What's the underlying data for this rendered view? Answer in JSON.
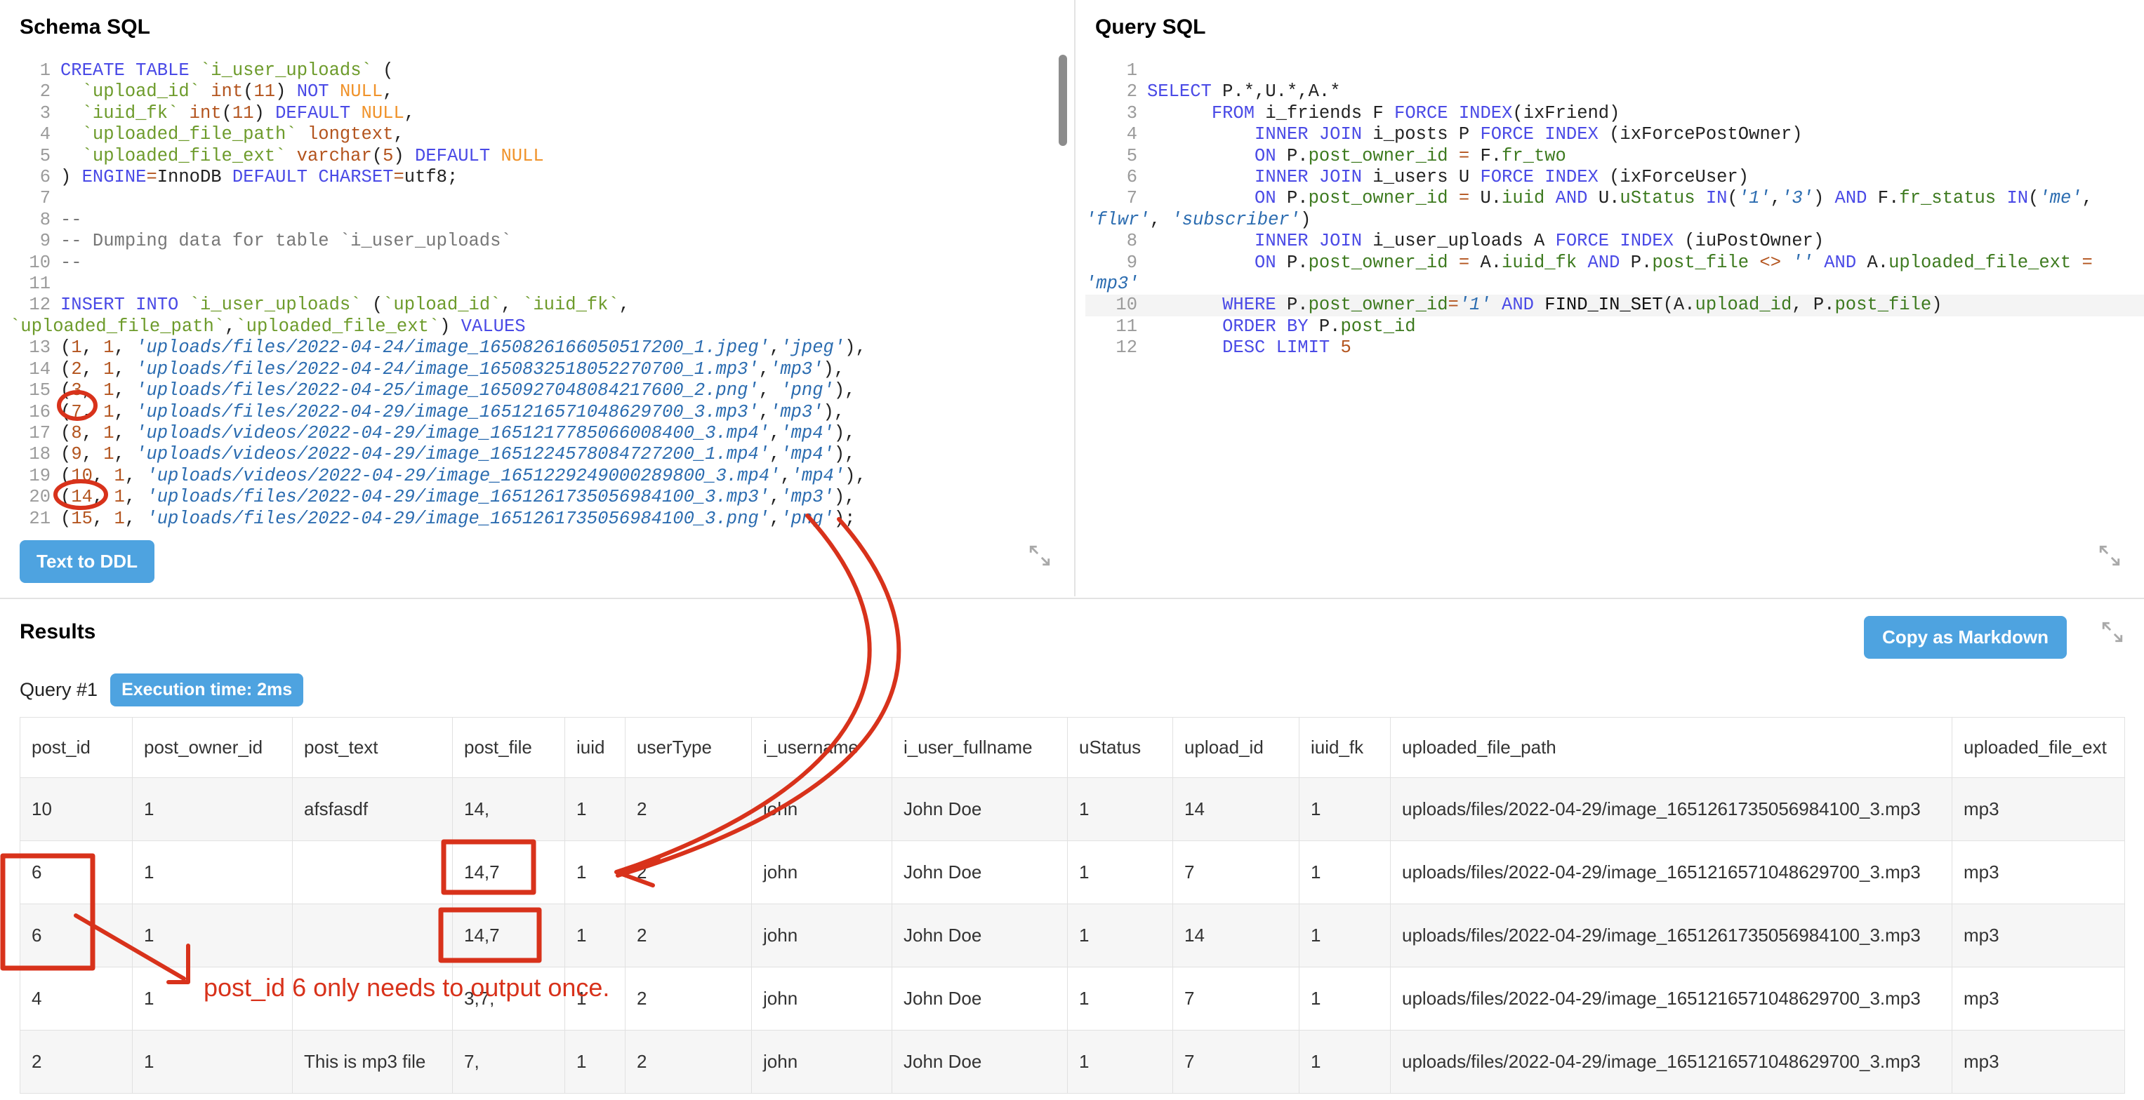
{
  "schema_panel": {
    "title": "Schema SQL",
    "button_label": "Text to DDL",
    "lines": [
      {
        "n": "1",
        "text": "CREATE TABLE `i_user_uploads` ("
      },
      {
        "n": "2",
        "text": "  `upload_id` int(11) NOT NULL,"
      },
      {
        "n": "3",
        "text": "  `iuid_fk` int(11) DEFAULT NULL,"
      },
      {
        "n": "4",
        "text": "  `uploaded_file_path` longtext,"
      },
      {
        "n": "5",
        "text": "  `uploaded_file_ext` varchar(5) DEFAULT NULL"
      },
      {
        "n": "6",
        "text": ") ENGINE=InnoDB DEFAULT CHARSET=utf8;"
      },
      {
        "n": "7",
        "text": ""
      },
      {
        "n": "8",
        "text": "--"
      },
      {
        "n": "9",
        "text": "-- Dumping data for table `i_user_uploads`"
      },
      {
        "n": "10",
        "text": "--"
      },
      {
        "n": "11",
        "text": ""
      },
      {
        "n": "12",
        "text": "INSERT INTO `i_user_uploads` (`upload_id`, `iuid_fk`, `uploaded_file_path`,`uploaded_file_ext`) VALUES"
      },
      {
        "n": "13",
        "text": "(1, 1, 'uploads/files/2022-04-24/image_1650826166050517200_1.jpeg','jpeg'),"
      },
      {
        "n": "14",
        "text": "(2, 1, 'uploads/files/2022-04-24/image_1650832518052270700_1.mp3','mp3'),"
      },
      {
        "n": "15",
        "text": "(3, 1, 'uploads/files/2022-04-25/image_1650927048084217600_2.png', 'png'),"
      },
      {
        "n": "16",
        "text": "(7, 1, 'uploads/files/2022-04-29/image_1651216571048629700_3.mp3','mp3'),"
      },
      {
        "n": "17",
        "text": "(8, 1, 'uploads/videos/2022-04-29/image_1651217785066008400_3.mp4','mp4'),"
      },
      {
        "n": "18",
        "text": "(9, 1, 'uploads/videos/2022-04-29/image_1651224578084727200_1.mp4','mp4'),"
      },
      {
        "n": "19",
        "text": "(10, 1, 'uploads/videos/2022-04-29/image_1651229249000289800_3.mp4','mp4'),"
      },
      {
        "n": "20",
        "text": "(14, 1, 'uploads/files/2022-04-29/image_1651261735056984100_3.mp3','mp3'),"
      },
      {
        "n": "21",
        "text": "(15, 1, 'uploads/files/2022-04-29/image_1651261735056984100_3.png','png');"
      }
    ]
  },
  "query_panel": {
    "title": "Query SQL",
    "lines": [
      {
        "n": "1",
        "text": ""
      },
      {
        "n": "2",
        "text": "SELECT P.*,U.*,A.*"
      },
      {
        "n": "3",
        "text": "      FROM i_friends F FORCE INDEX(ixFriend)"
      },
      {
        "n": "4",
        "text": "          INNER JOIN i_posts P FORCE INDEX (ixForcePostOwner)"
      },
      {
        "n": "5",
        "text": "          ON P.post_owner_id = F.fr_two"
      },
      {
        "n": "6",
        "text": "          INNER JOIN i_users U FORCE INDEX (ixForceUser)"
      },
      {
        "n": "7",
        "text": "          ON P.post_owner_id = U.iuid AND U.uStatus IN('1','3') AND F.fr_status IN('me', 'flwr', 'subscriber')"
      },
      {
        "n": "8",
        "text": "          INNER JOIN i_user_uploads A FORCE INDEX (iuPostOwner)"
      },
      {
        "n": "9",
        "text": "          ON P.post_owner_id = A.iuid_fk AND P.post_file <> '' AND A.uploaded_file_ext = 'mp3'"
      },
      {
        "n": "10",
        "text": "       WHERE P.post_owner_id='1' AND FIND_IN_SET(A.upload_id, P.post_file)"
      },
      {
        "n": "11",
        "text": "       ORDER BY P.post_id"
      },
      {
        "n": "12",
        "text": "       DESC LIMIT 5"
      }
    ]
  },
  "results": {
    "title": "Results",
    "copy_label": "Copy as Markdown",
    "query_label": "Query #1",
    "exec_time": "Execution time: 2ms",
    "columns": [
      "post_id",
      "post_owner_id",
      "post_text",
      "post_file",
      "iuid",
      "userType",
      "i_username",
      "i_user_fullname",
      "uStatus",
      "upload_id",
      "iuid_fk",
      "uploaded_file_path",
      "uploaded_file_ext"
    ],
    "rows": [
      [
        "10",
        "1",
        "afsfasdf",
        "14,",
        "1",
        "2",
        "john",
        "John Doe",
        "1",
        "14",
        "1",
        "uploads/files/2022-04-29/image_1651261735056984100_3.mp3",
        "mp3"
      ],
      [
        "6",
        "1",
        "",
        "14,7",
        "1",
        "2",
        "john",
        "John Doe",
        "1",
        "7",
        "1",
        "uploads/files/2022-04-29/image_1651216571048629700_3.mp3",
        "mp3"
      ],
      [
        "6",
        "1",
        "",
        "14,7",
        "1",
        "2",
        "john",
        "John Doe",
        "1",
        "14",
        "1",
        "uploads/files/2022-04-29/image_1651261735056984100_3.mp3",
        "mp3"
      ],
      [
        "4",
        "1",
        "",
        "3,7,",
        "1",
        "2",
        "john",
        "John Doe",
        "1",
        "7",
        "1",
        "uploads/files/2022-04-29/image_1651216571048629700_3.mp3",
        "mp3"
      ],
      [
        "2",
        "1",
        "This is mp3 file",
        "7,",
        "1",
        "2",
        "john",
        "John Doe",
        "1",
        "7",
        "1",
        "uploads/files/2022-04-29/image_1651216571048629700_3.mp3",
        "mp3"
      ]
    ]
  },
  "annotations": {
    "note": "post_id 6 only needs to output once.",
    "color": "#d8321b"
  }
}
